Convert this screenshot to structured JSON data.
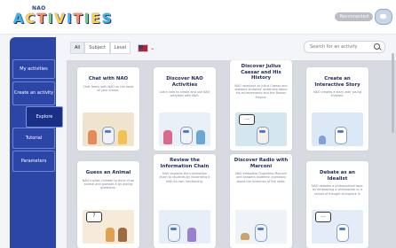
{
  "app": {
    "logo_small": "NAO",
    "logo_letters": [
      "A",
      "C",
      "T",
      "I",
      "V",
      "I",
      "T",
      "I",
      "E",
      "S"
    ]
  },
  "header": {
    "status_badge": "Reconnected"
  },
  "sidebar": {
    "items": [
      {
        "label": "My activities"
      },
      {
        "label": "Create an activity"
      },
      {
        "label": "Explore"
      },
      {
        "label": "Tutorial"
      },
      {
        "label": "Parameters"
      }
    ]
  },
  "filters": {
    "tabs": [
      "All",
      "Subject",
      "Level"
    ],
    "language_icon": "us-flag-icon",
    "search_placeholder": "Search for an activity"
  },
  "cards": [
    {
      "title": "Chat with NAO",
      "desc": "Chat freely with NAO on the topic of your choice."
    },
    {
      "title": "Discover NAO Activities",
      "desc": "Learn how to create and use NAO activities with NAO."
    },
    {
      "title": "Discover Julius Caesar and His History",
      "desc": "NAO roleplays as Julius Caesar and answers students' questions about his achievements and the Roman Empire."
    },
    {
      "title": "Create an Interactive Story",
      "desc": "NAO creates a story with young children."
    },
    {
      "title": "Guess an Animal",
      "desc": "NAO invites children to think of an animal and guesses it by asking questions."
    },
    {
      "title": "Review the Information Chain",
      "desc": "NAO explains the information chain to students by illustrating it with its own functioning."
    },
    {
      "title": "Discover Radio with Marconi",
      "desc": "NAO embodies Guglielmo Marconi and answers students' questions about the invention of the radio."
    },
    {
      "title": "Debate as an Idealist",
      "desc": "NAO debates a philosophical topic by embodying a philosopher or a school of thought to explore it."
    }
  ],
  "colors": {
    "sidebar_bg": "#2c46a8",
    "sidebar_active": "#1a2f86",
    "title_text": "#1c2b55"
  }
}
